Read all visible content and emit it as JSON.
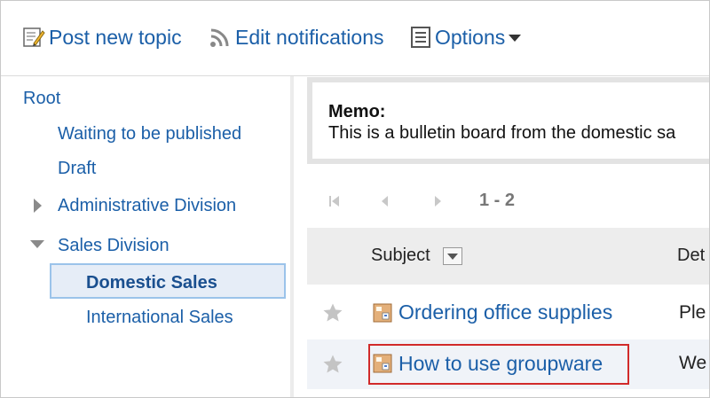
{
  "toolbar": {
    "post_new_topic": "Post new topic",
    "edit_notifications": "Edit notifications",
    "options": "Options"
  },
  "tree": {
    "root": "Root",
    "waiting": "Waiting to be published",
    "draft": "Draft",
    "admin_division": "Administrative Division",
    "sales_division": "Sales Division",
    "domestic_sales": "Domestic Sales",
    "international_sales": "International Sales"
  },
  "memo": {
    "title": "Memo:",
    "text": "This is a bulletin board from the domestic sa"
  },
  "pager": {
    "range": "1 - 2"
  },
  "table": {
    "subject_header": "Subject",
    "detail_header": "Det",
    "rows": [
      {
        "subject": "Ordering office supplies",
        "detail": "Ple"
      },
      {
        "subject": "How to use groupware",
        "detail": "We"
      }
    ]
  },
  "colors": {
    "link": "#1b5fa8",
    "highlight_border": "#d12a2a",
    "selected_bg": "#e6edf7",
    "selected_border": "#9bc3ea"
  }
}
